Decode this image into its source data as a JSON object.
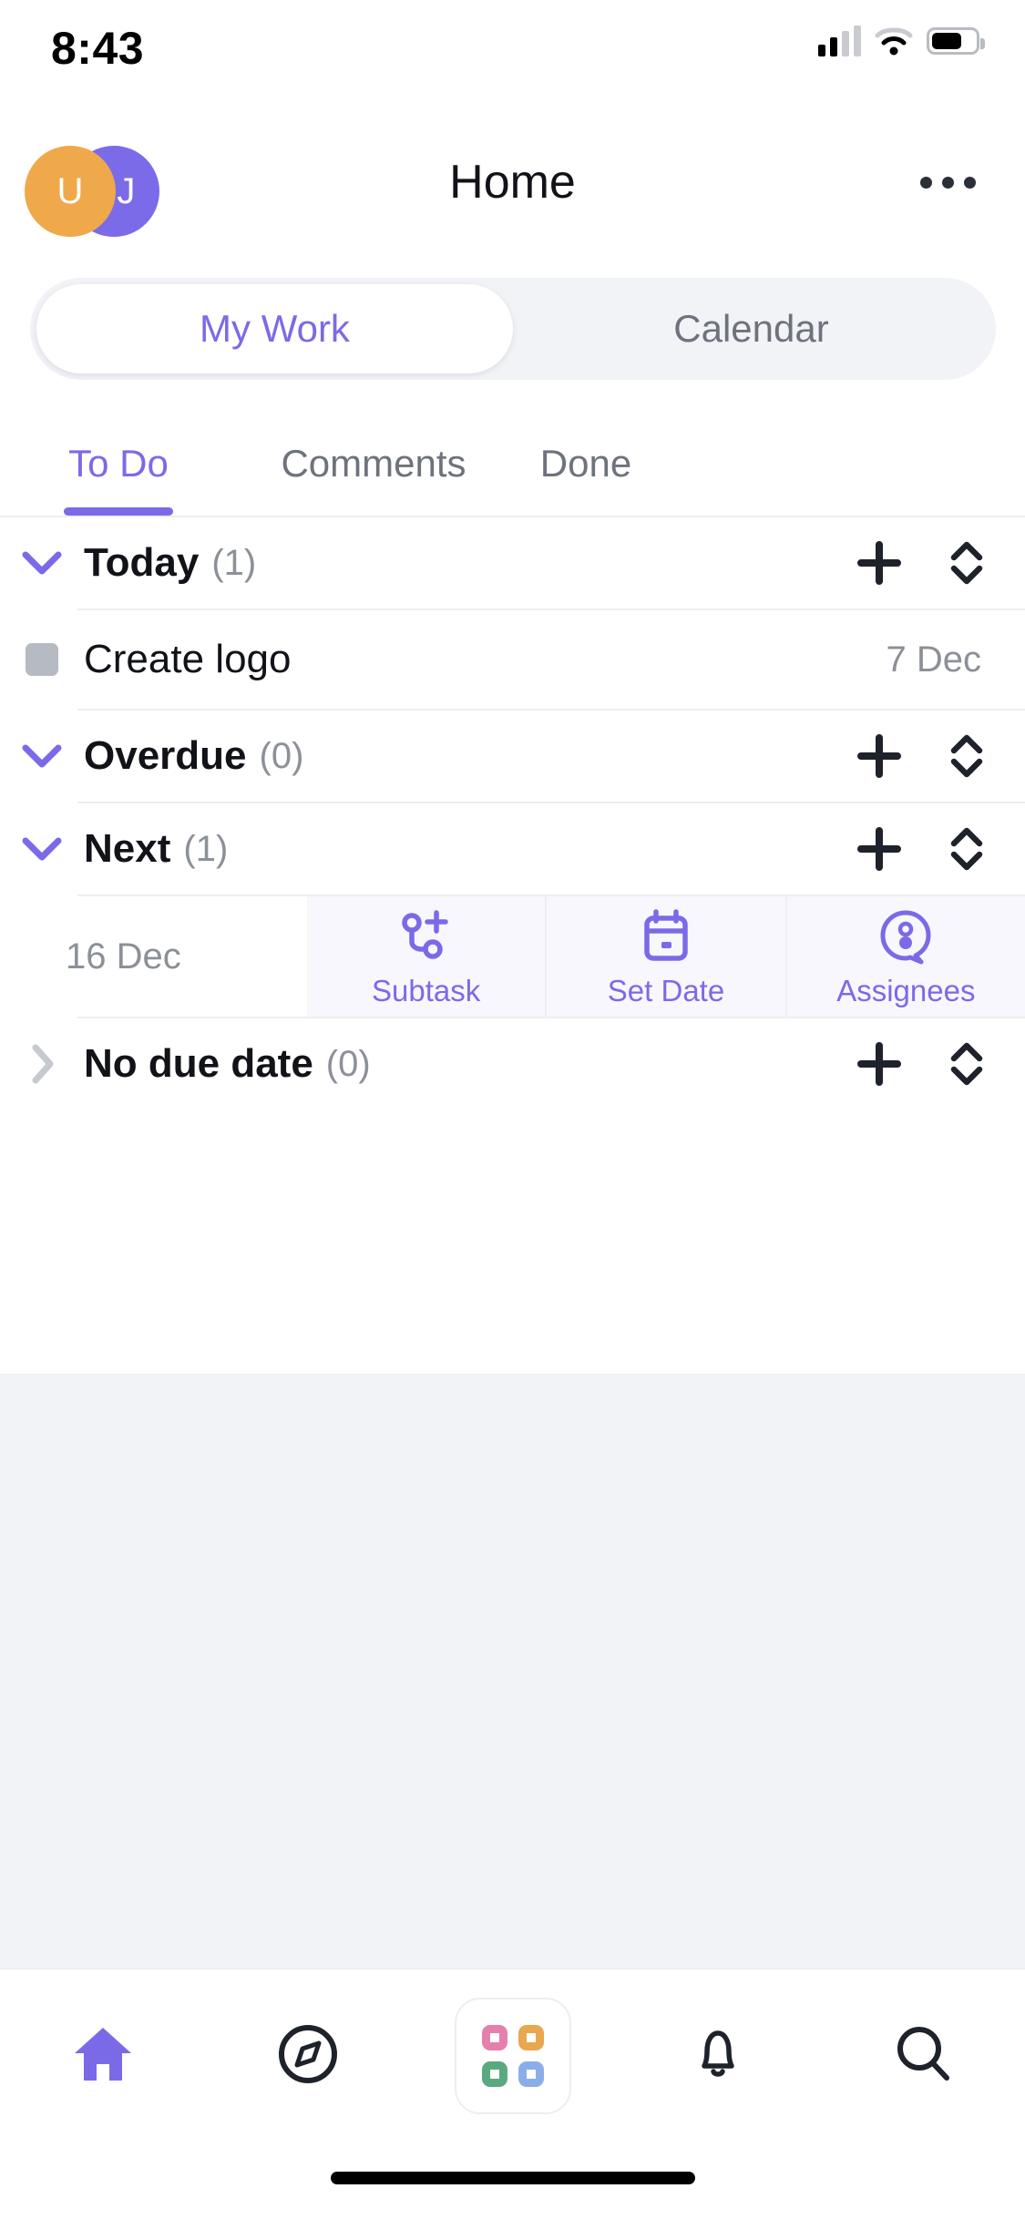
{
  "status_bar": {
    "time": "8:43",
    "icons": [
      "cellular-signal-icon",
      "wifi-icon",
      "battery-icon"
    ],
    "battery_level_pct": 62
  },
  "header": {
    "title": "Home",
    "avatars": [
      {
        "initials": "U",
        "color": "#EFA94A",
        "name": "avatar-user"
      },
      {
        "initials": "SJ",
        "color": "#7C6BE8",
        "name": "avatar-sj"
      }
    ],
    "more_icon": "more-horizontal-icon"
  },
  "segmented_control": {
    "active": "My Work",
    "options": [
      {
        "label": "My Work",
        "active": true
      },
      {
        "label": "Calendar",
        "active": false
      }
    ]
  },
  "sub_tabs": {
    "active": "To Do",
    "items": [
      {
        "label": "To Do",
        "active": true
      },
      {
        "label": "Comments",
        "active": false
      },
      {
        "label": "Done",
        "active": false
      }
    ]
  },
  "sections": [
    {
      "title": "Today",
      "count": "(1)",
      "expanded": true,
      "chevron_icon": "chevron-down-icon",
      "add_icon": "plus-icon",
      "sort_icon": "sort-updown-icon",
      "tasks": [
        {
          "title": "Create logo",
          "date": "7 Dec",
          "checkbox_icon": "checkbox-unchecked-icon"
        }
      ]
    },
    {
      "title": "Overdue",
      "count": "(0)",
      "expanded": true,
      "chevron_icon": "chevron-down-icon",
      "add_icon": "plus-icon",
      "sort_icon": "sort-updown-icon",
      "tasks": []
    },
    {
      "title": "Next",
      "count": "(1)",
      "expanded": true,
      "chevron_icon": "chevron-down-icon",
      "add_icon": "plus-icon",
      "sort_icon": "sort-updown-icon",
      "tasks": []
    },
    {
      "title": "No due date",
      "count": "(0)",
      "expanded": false,
      "chevron_icon": "chevron-right-icon",
      "add_icon": "plus-icon",
      "sort_icon": "sort-updown-icon",
      "tasks": []
    }
  ],
  "swipe_row": {
    "date": "16 Dec",
    "actions": [
      {
        "label": "Subtask",
        "icon": "subtask-add-icon"
      },
      {
        "label": "Set Date",
        "icon": "calendar-icon"
      },
      {
        "label": "Assignees",
        "icon": "assignee-icon"
      }
    ],
    "accent_color": "#7B6AE8",
    "panel_bg": "#F8F7FE"
  },
  "bottom_nav": {
    "items": [
      {
        "icon": "home-icon",
        "active": true
      },
      {
        "icon": "compass-icon",
        "active": false
      },
      {
        "icon": "apps-grid-icon",
        "active": false
      },
      {
        "icon": "bell-icon",
        "active": false
      },
      {
        "icon": "search-icon",
        "active": false
      }
    ],
    "apps_colors": [
      "#E580AC",
      "#E8A84F",
      "#5BA97F",
      "#8BAEE8"
    ]
  },
  "colors": {
    "accent": "#7B6AE8",
    "text": "#111318",
    "muted": "#8C9098",
    "divider": "#EDEEF2",
    "filler_bg": "#F2F3F7"
  }
}
